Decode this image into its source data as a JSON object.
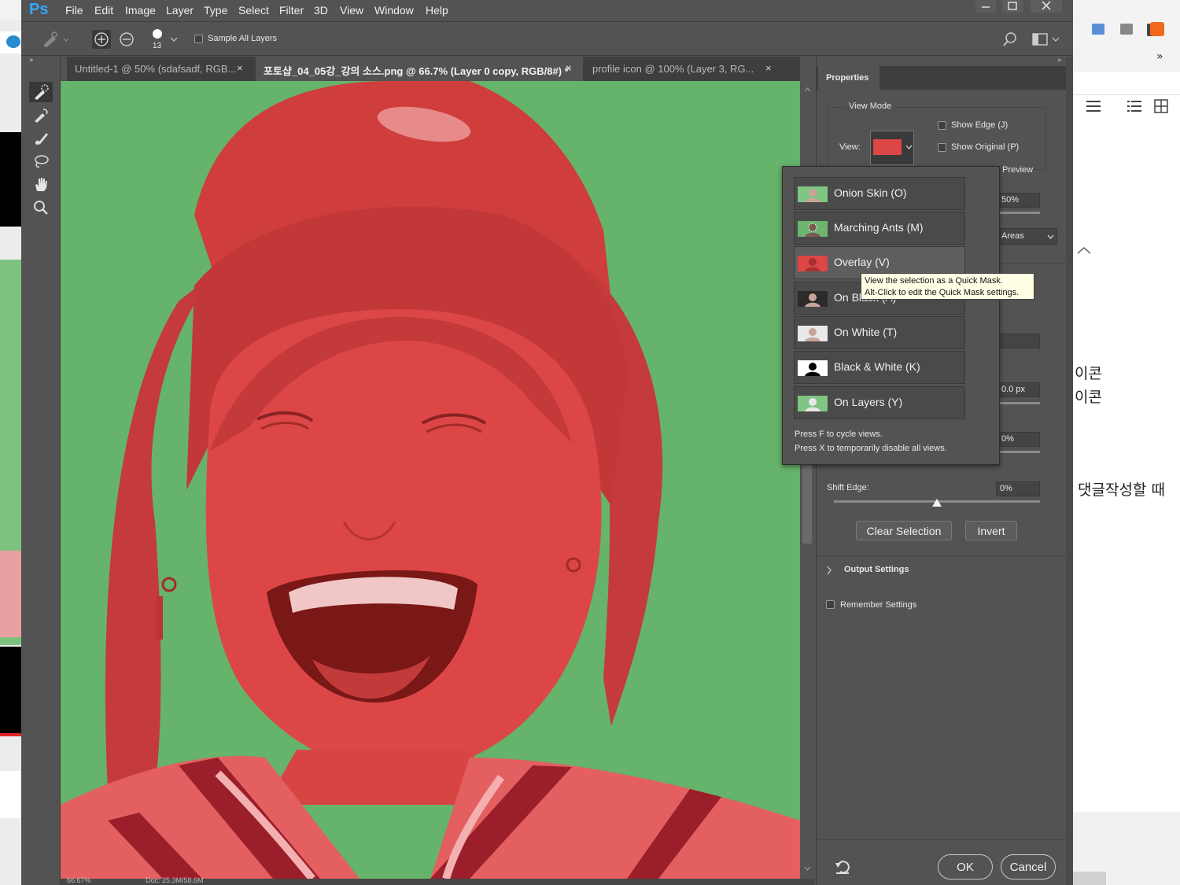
{
  "app": {
    "logo": "Ps"
  },
  "menu": [
    "File",
    "Edit",
    "Image",
    "Layer",
    "Type",
    "Select",
    "Filter",
    "3D",
    "View",
    "Window",
    "Help"
  ],
  "window_controls": [
    "minimize-icon",
    "maximize-icon",
    "close-icon"
  ],
  "options_bar": {
    "brush_size": "13",
    "sample_all_layers": "Sample All Layers",
    "sample_all_layers_checked": false
  },
  "tabs": [
    {
      "label": "Untitled-1 @ 50% (sdafsadf, RGB...",
      "close": "×",
      "active": false
    },
    {
      "label": "포토샵_04_05강_강의 소스.png @ 66.7% (Layer 0 copy, RGB/8#) *",
      "close": "×",
      "active": true
    },
    {
      "label": "profile icon @ 100% (Layer 3, RG...",
      "close": "×",
      "active": false
    }
  ],
  "tools": [
    "quick-selection-tool-icon",
    "refine-edge-brush-icon",
    "brush-tool-icon",
    "lasso-tool-icon",
    "hand-tool-icon",
    "zoom-tool-icon"
  ],
  "status": {
    "zoom": "66.67%",
    "doc": "Doc: 25.3M/58.6M"
  },
  "properties": {
    "tab": "Properties",
    "view_mode_label": "View Mode",
    "view_label": "View:",
    "show_edge": "Show Edge (J)",
    "show_original": "Show Original (P)",
    "preview": "Preview",
    "opacity_value": "50%",
    "areas_value": "Areas",
    "radius_value": "0.0 px",
    "contrast_value": "0%",
    "shift_edge_label": "Shift Edge:",
    "shift_edge_value": "0%",
    "shift_edge_level": 0.5,
    "clear_selection": "Clear Selection",
    "invert": "Invert",
    "output_settings": "Output Settings",
    "remember_settings": "Remember Settings",
    "ok": "OK",
    "cancel": "Cancel"
  },
  "view_dropdown": {
    "items": [
      {
        "label": "Onion Skin (O)",
        "thumb": "onion-skin"
      },
      {
        "label": "Marching Ants (M)",
        "thumb": "marching-ants"
      },
      {
        "label": "Overlay (V)",
        "thumb": "overlay",
        "highlighted": true
      },
      {
        "label": "On Black (A)",
        "thumb": "on-black"
      },
      {
        "label": "On White (T)",
        "thumb": "on-white"
      },
      {
        "label": "Black & White (K)",
        "thumb": "black-white"
      },
      {
        "label": "On Layers (Y)",
        "thumb": "on-layers"
      }
    ],
    "hint1": "Press F to cycle views.",
    "hint2": "Press X to temporarily disable all views.",
    "tooltip1": "View the selection as a Quick Mask.",
    "tooltip2": "Alt-Click to edit the Quick Mask settings."
  },
  "background_page": {
    "texts": [
      "이콘",
      "이콘",
      "댓글작성할 때"
    ]
  },
  "colors": {
    "overlay_red": "#dd4747",
    "canvas_green": "#66b36b",
    "ps_gray": "#535353"
  }
}
